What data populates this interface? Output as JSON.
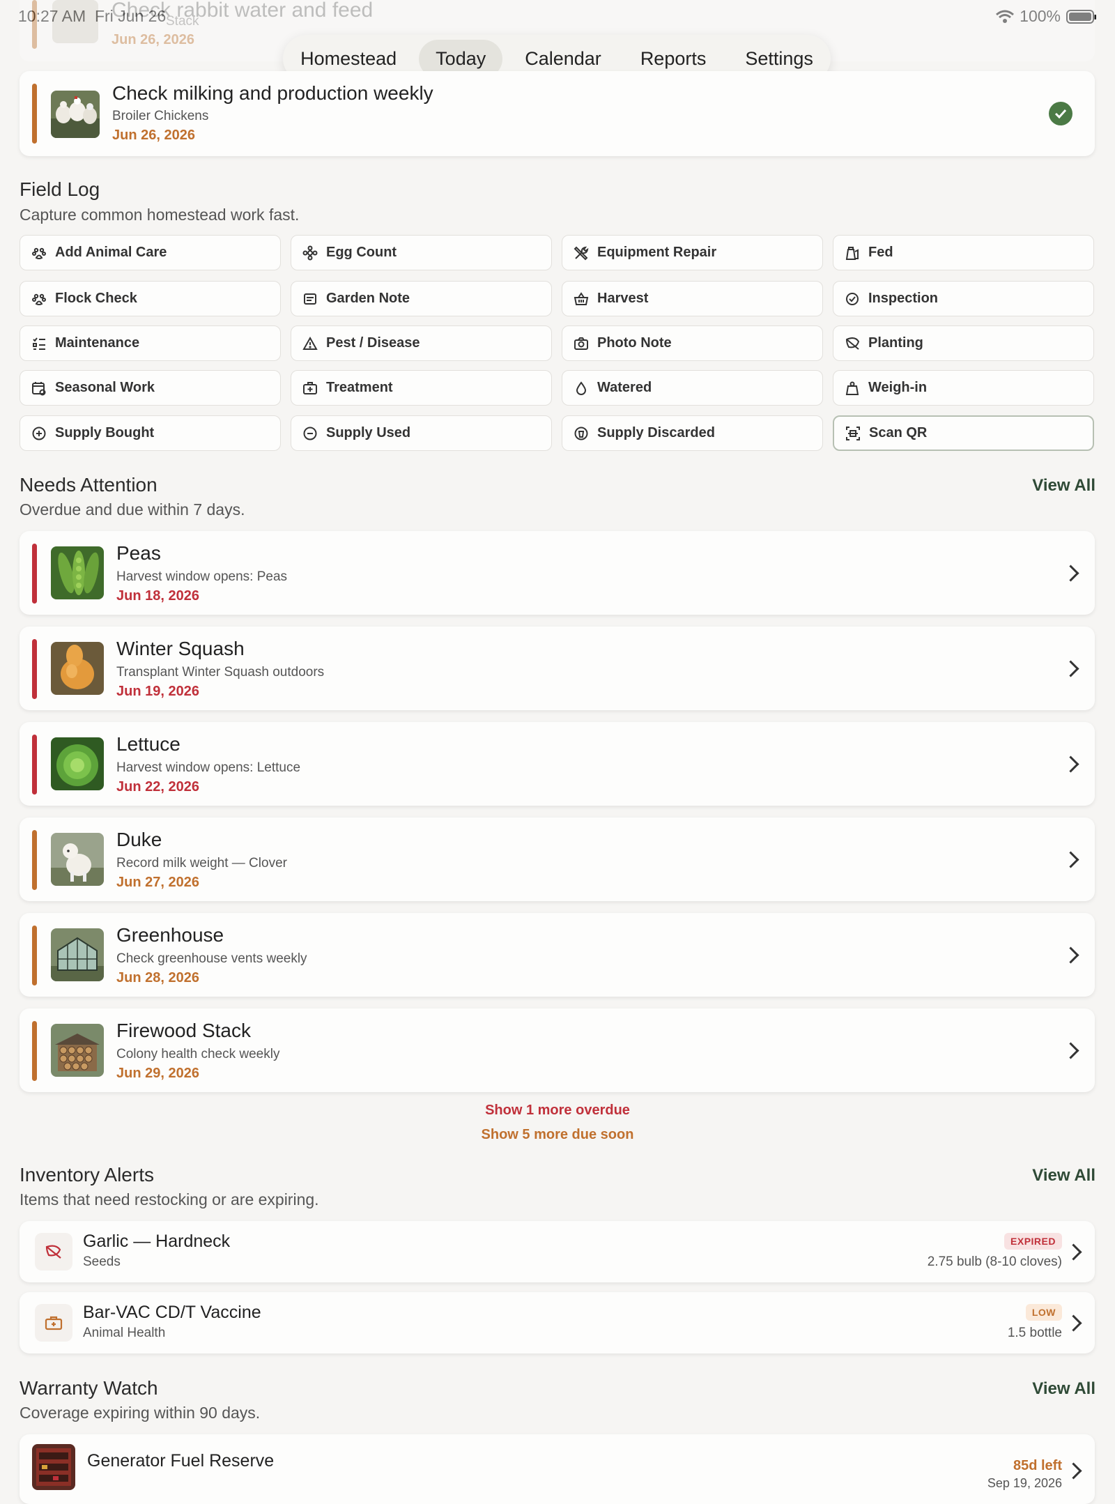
{
  "status": {
    "time": "10:27 AM",
    "date": "Fri Jun 26",
    "battery": "100%"
  },
  "faded_card": {
    "title": "Check rabbit water and feed",
    "subtitle": "Stack",
    "date": "Jun 26, 2026"
  },
  "nav": {
    "tabs": [
      "Homestead",
      "Today",
      "Calendar",
      "Reports",
      "Settings"
    ],
    "active": "Today"
  },
  "top_task": {
    "title": "Check milking and production weekly",
    "subtitle": "Broiler Chickens",
    "date": "Jun 26, 2026",
    "completed": true
  },
  "field_log": {
    "title": "Field Log",
    "subtitle": "Capture common homestead work fast.",
    "buttons": [
      {
        "label": "Add Animal Care",
        "icon": "paw-icon"
      },
      {
        "label": "Egg Count",
        "icon": "egg-flower-icon"
      },
      {
        "label": "Equipment Repair",
        "icon": "tools-icon"
      },
      {
        "label": "Fed",
        "icon": "feed-bag-icon"
      },
      {
        "label": "Flock Check",
        "icon": "paw-icon"
      },
      {
        "label": "Garden Note",
        "icon": "note-icon"
      },
      {
        "label": "Harvest",
        "icon": "basket-icon"
      },
      {
        "label": "Inspection",
        "icon": "badge-check-icon"
      },
      {
        "label": "Maintenance",
        "icon": "checklist-icon"
      },
      {
        "label": "Pest / Disease",
        "icon": "warning-icon"
      },
      {
        "label": "Photo Note",
        "icon": "camera-icon"
      },
      {
        "label": "Planting",
        "icon": "leaf-icon"
      },
      {
        "label": "Seasonal Work",
        "icon": "calendar-icon"
      },
      {
        "label": "Treatment",
        "icon": "medkit-icon"
      },
      {
        "label": "Watered",
        "icon": "drop-icon"
      },
      {
        "label": "Weigh-in",
        "icon": "weight-icon"
      },
      {
        "label": "Supply Bought",
        "icon": "plus-circle-icon"
      },
      {
        "label": "Supply Used",
        "icon": "minus-circle-icon"
      },
      {
        "label": "Supply Discarded",
        "icon": "trash-circle-icon"
      },
      {
        "label": "Scan QR",
        "icon": "qr-scan-icon"
      }
    ]
  },
  "needs_attention": {
    "title": "Needs Attention",
    "subtitle": "Overdue and due within 7 days.",
    "view_all": "View All",
    "items": [
      {
        "title": "Peas",
        "subtitle": "Harvest window opens: Peas",
        "date": "Jun 18, 2026",
        "status": "overdue",
        "thumb": "peas"
      },
      {
        "title": "Winter Squash",
        "subtitle": "Transplant Winter Squash outdoors",
        "date": "Jun 19, 2026",
        "status": "overdue",
        "thumb": "squash"
      },
      {
        "title": "Lettuce",
        "subtitle": "Harvest window opens: Lettuce",
        "date": "Jun 22, 2026",
        "status": "overdue",
        "thumb": "lettuce"
      },
      {
        "title": "Duke",
        "subtitle": "Record milk weight — Clover",
        "date": "Jun 27, 2026",
        "status": "soon",
        "thumb": "dog"
      },
      {
        "title": "Greenhouse",
        "subtitle": "Check greenhouse vents weekly",
        "date": "Jun 28, 2026",
        "status": "soon",
        "thumb": "greenhouse"
      },
      {
        "title": "Firewood Stack",
        "subtitle": "Colony health check weekly",
        "date": "Jun 29, 2026",
        "status": "soon",
        "thumb": "firewood"
      }
    ],
    "show_overdue": "Show 1 more overdue",
    "show_soon": "Show 5 more due soon"
  },
  "inventory_alerts": {
    "title": "Inventory Alerts",
    "subtitle": "Items that need restocking or are expiring.",
    "view_all": "View All",
    "items": [
      {
        "title": "Garlic — Hardneck",
        "category": "Seeds",
        "badge": "EXPIRED",
        "quantity": "2.75 bulb (8-10 cloves)",
        "icon": "leaf-icon"
      },
      {
        "title": "Bar-VAC CD/T Vaccine",
        "category": "Animal Health",
        "badge": "LOW",
        "quantity": "1.5 bottle",
        "icon": "medkit-icon"
      }
    ]
  },
  "warranty_watch": {
    "title": "Warranty Watch",
    "subtitle": "Coverage expiring within 90 days.",
    "view_all": "View All",
    "items": [
      {
        "title": "Generator Fuel Reserve",
        "remaining": "85d left",
        "expires": "Sep 19, 2026"
      }
    ]
  },
  "colors": {
    "overdue": "#c0303a",
    "soon": "#c0702e",
    "accent_green": "#2f4a36",
    "check_green": "#4b7a45"
  }
}
